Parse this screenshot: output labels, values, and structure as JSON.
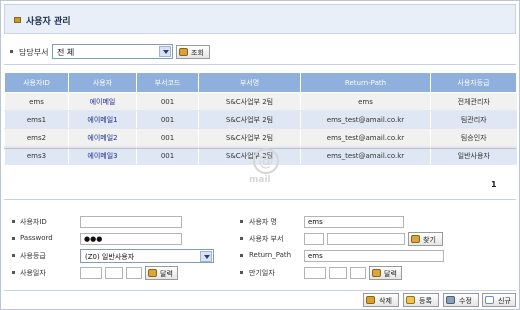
{
  "title": "사용자 관리",
  "filter": {
    "label": "담당부서",
    "dept_value": "전 체",
    "search_label": "조회"
  },
  "table": {
    "headers": [
      "사용자ID",
      "사용자",
      "부서코드",
      "부서명",
      "Return-Path",
      "사용자등급"
    ],
    "rows": [
      [
        "ems",
        "에이메일",
        "001",
        "S&C사업부 2팀",
        "ems",
        "전체관리자"
      ],
      [
        "ems1",
        "에이메일1",
        "001",
        "S&C사업부 2팀",
        "ems_test@amail.co.kr",
        "팀관리자"
      ],
      [
        "ems2",
        "에이메일2",
        "001",
        "S&C사업부 2팀",
        "ems_test@amail.co.kr",
        "팀승인자"
      ],
      [
        "ems3",
        "에이메일3",
        "001",
        "S&C사업부 2팀",
        "ems_test@amail.co.kr",
        "일반사용자"
      ]
    ]
  },
  "pager": {
    "page": "1"
  },
  "form": {
    "user_id_label": "사용자ID",
    "user_id_value": "",
    "password_label": "Password",
    "password_value": "●●●",
    "grade_label": "사용등급",
    "grade_value": "(Z0) 일반사용자",
    "start_date_label": "사용일자",
    "calendar_label": "달력",
    "user_name_label": "사용자 명",
    "user_name_value": "ems",
    "dept_label": "사용자 부서",
    "find_label": "찾기",
    "return_path_label": "Return_Path",
    "return_path_value": "ems",
    "end_date_label": "만기일자"
  },
  "actions": {
    "delete_label": "삭제",
    "register_label": "등록",
    "edit_label": "수정",
    "new_label": "신규"
  },
  "watermark": {
    "symbol": "@",
    "text": "mail"
  },
  "colors": {
    "header_bg": "#8fb0dc",
    "row_alt": "#dfe7f4",
    "link": "#1a2a8f"
  }
}
